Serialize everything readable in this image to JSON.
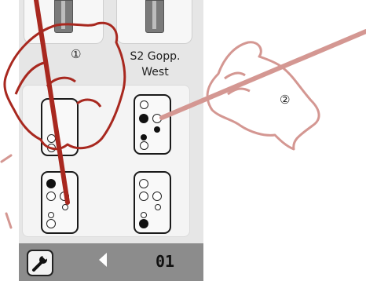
{
  "station": {
    "name_line1": "S2 Gopp.",
    "name_line2": "West"
  },
  "footer": {
    "counter": "01"
  },
  "annotations": {
    "hand_1": "①",
    "hand_2": "②"
  },
  "icons": {
    "settings": "wrench-icon",
    "previous": "arrow-left-icon"
  },
  "colors": {
    "hand_1_stroke": "#a8281f",
    "hand_2_stroke": "#d49792",
    "panel_bg": "#e6e6e6",
    "footer_bg": "#8c8c8c"
  }
}
